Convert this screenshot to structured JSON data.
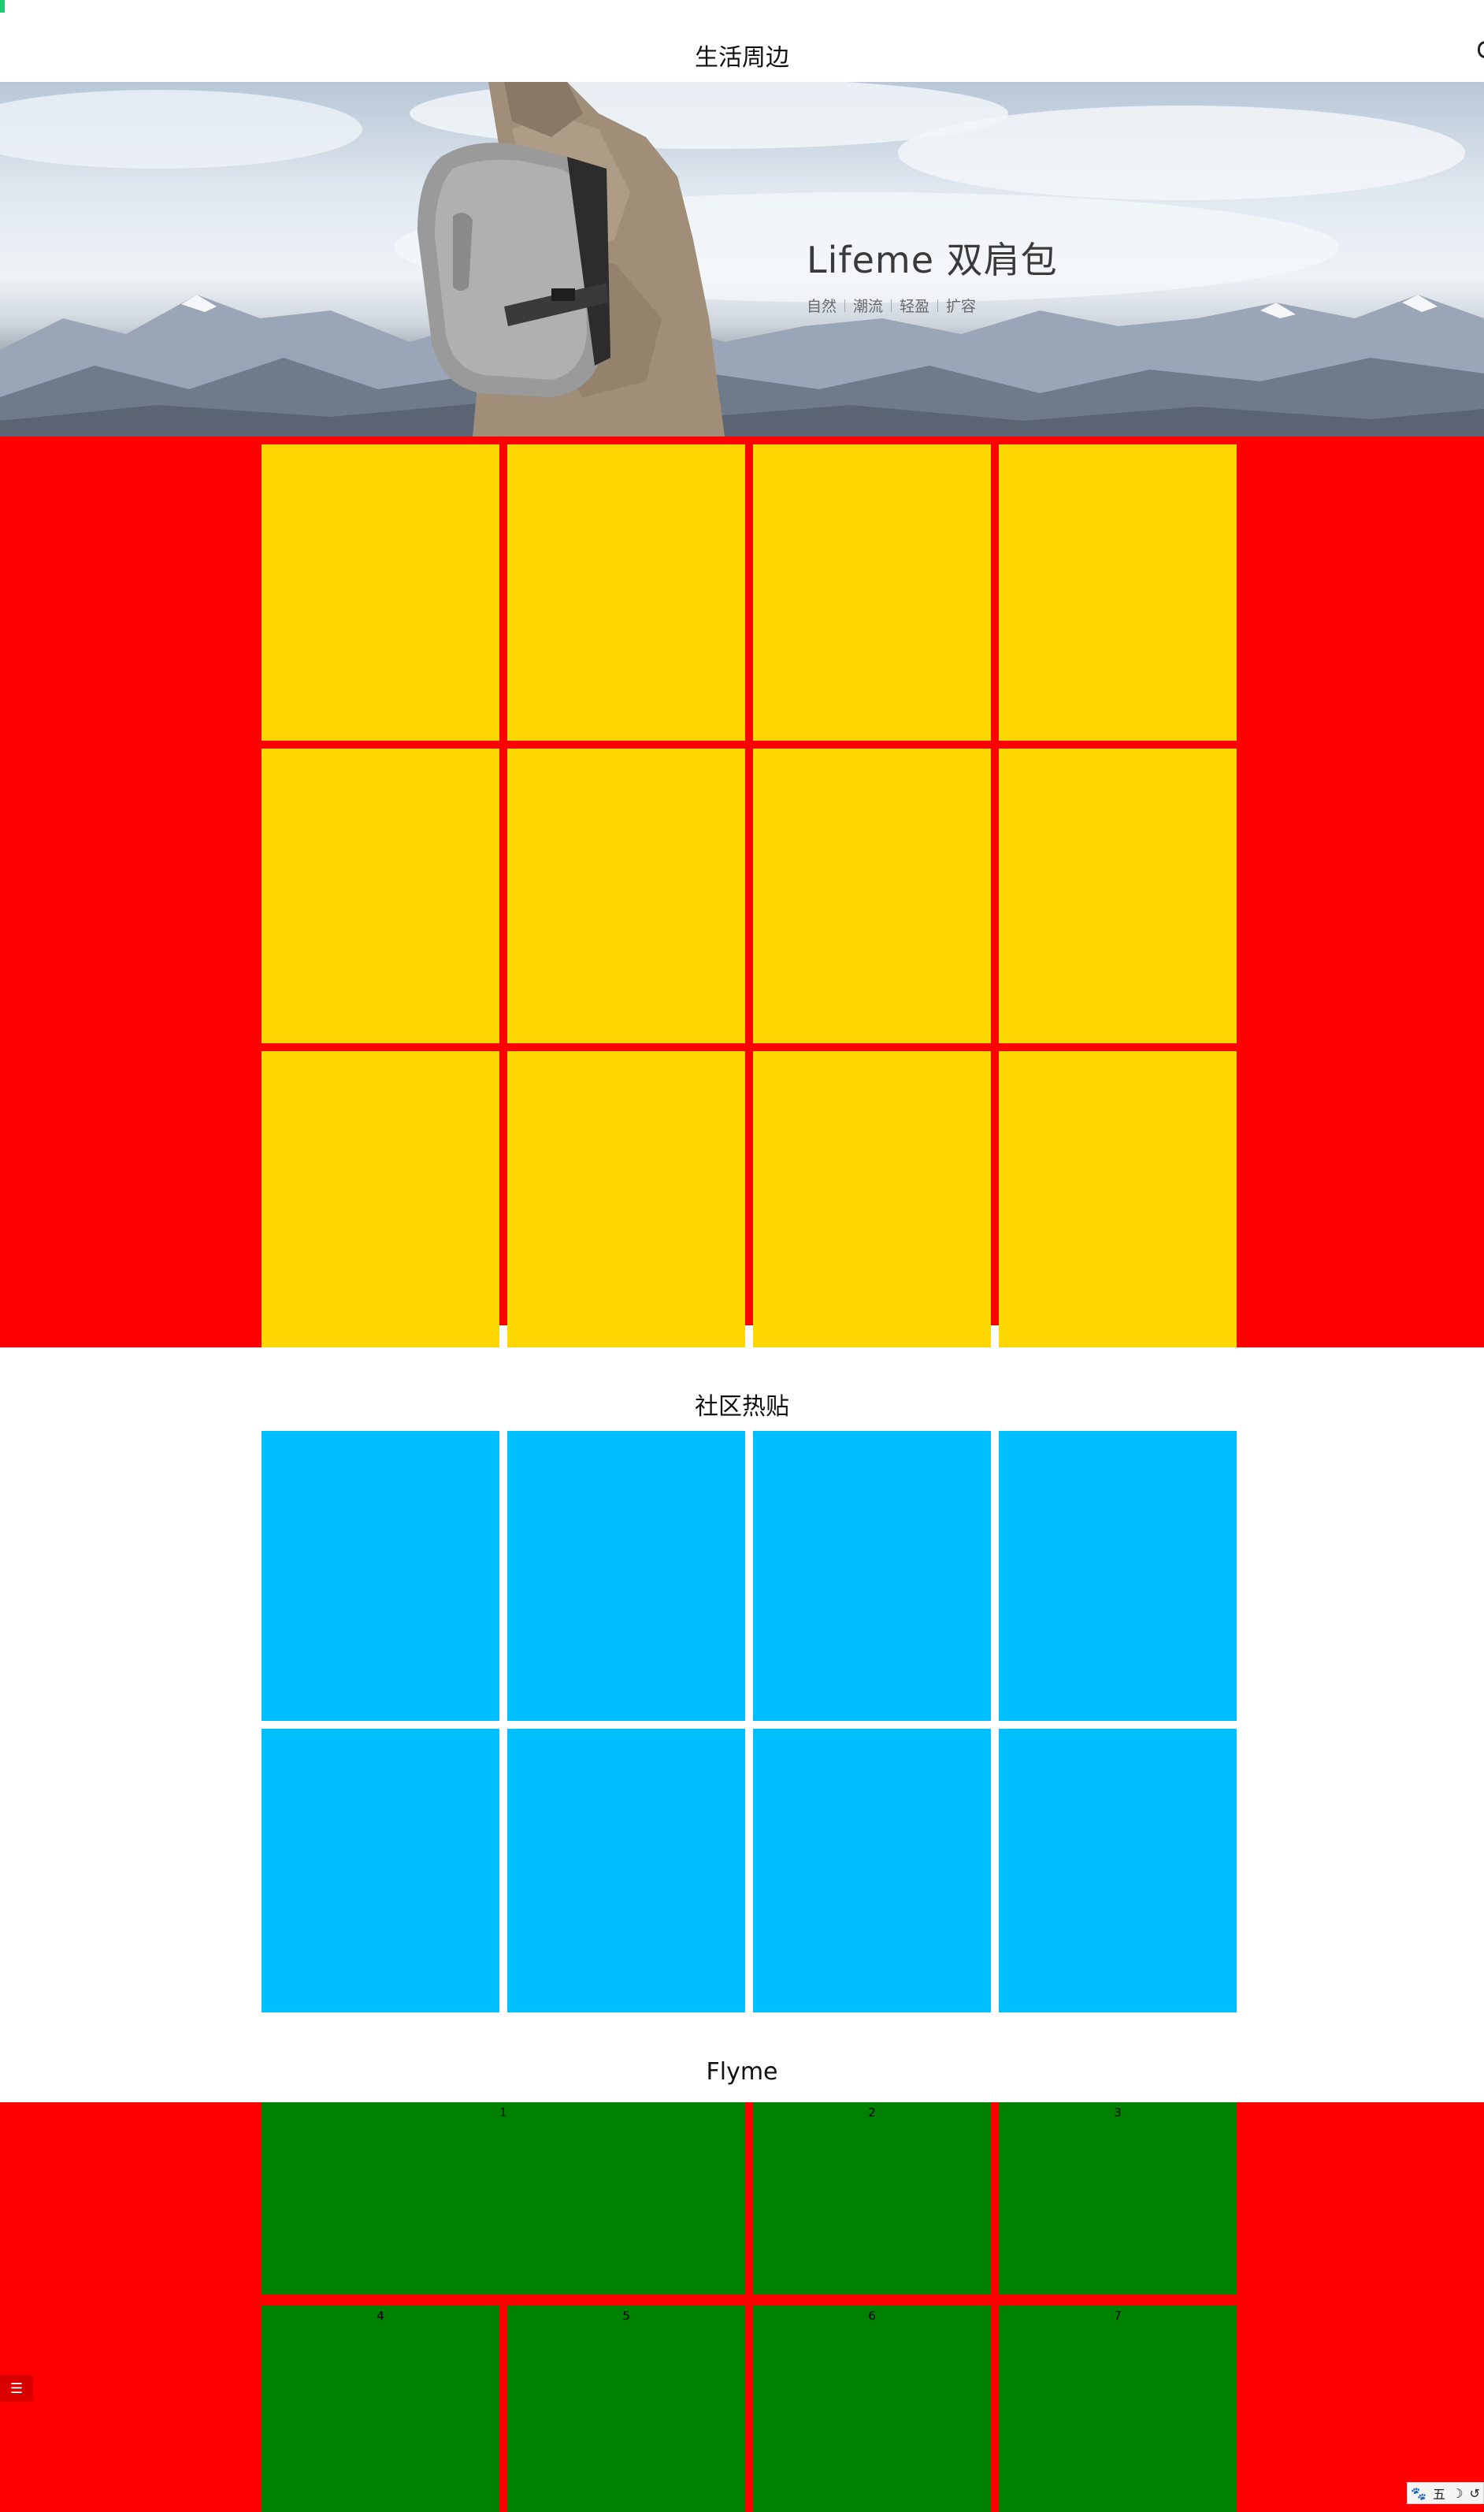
{
  "sections": {
    "life": {
      "title": "生活周边"
    },
    "community": {
      "title": "社区热贴"
    },
    "flyme": {
      "title": "Flyme"
    }
  },
  "banner": {
    "title": "Lifeme 双肩包",
    "tags": [
      "自然",
      "潮流",
      "轻盈",
      "扩容"
    ]
  },
  "flyme_tiles": [
    "1",
    "2",
    "3",
    "4",
    "5",
    "6",
    "7"
  ],
  "side_toggle": {
    "icon": "list-icon",
    "glyph": "☰"
  },
  "ime": {
    "icon": "paw-icon",
    "glyph": "🐾",
    "mode": "五",
    "moon": "☽",
    "extra": "↺"
  },
  "colors": {
    "red_band": "#ff0000",
    "yellow_tile": "#ffd700",
    "blue_tile": "#00bfff",
    "green_tile": "#008000",
    "scroll_thumb": "#1ecb70"
  }
}
